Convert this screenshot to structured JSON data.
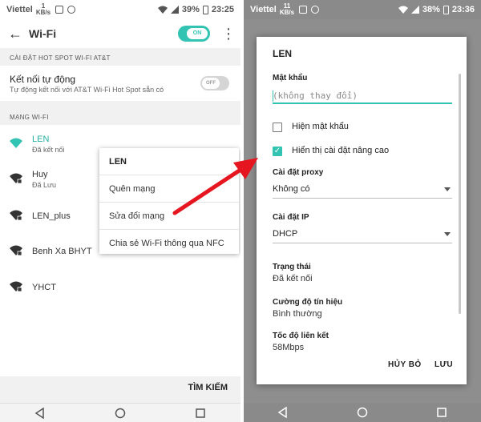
{
  "colors": {
    "accent": "#33c3b3",
    "arrow": "#e5161f"
  },
  "left": {
    "status": {
      "carrier": "Viettel",
      "mini_top": "1",
      "mini_bottom": "KB/s",
      "battery": "39%",
      "time": "23:25"
    },
    "appbar": {
      "title": "Wi-Fi",
      "toggle_label": "ON",
      "back_icon": "back-arrow-icon",
      "menu_icon": "more-vert-icon"
    },
    "hotspot_section": "CÀI ĐẶT HOT SPOT WI-FI AT&T",
    "auto_connect": {
      "title": "Kết nối tự động",
      "subtitle": "Tự động kết nối với AT&T Wi-Fi Hot Spot sẵn có",
      "toggle_label": "OFF"
    },
    "networks_section": "MẠNG WI-FI",
    "networks": [
      {
        "name": "LEN",
        "status": "Đã kết nối",
        "connected": true
      },
      {
        "name": "Huy",
        "status": "Đã Lưu",
        "connected": false
      },
      {
        "name": "LEN_plus",
        "status": "",
        "connected": false
      },
      {
        "name": "Benh Xa BHYT",
        "status": "",
        "connected": false
      },
      {
        "name": "YHCT",
        "status": "",
        "connected": false
      }
    ],
    "context_menu": {
      "title": "LEN",
      "items": [
        "Quên mạng",
        "Sửa đổi mạng",
        "Chia sẻ Wi-Fi thông qua NFC"
      ]
    },
    "search_label": "TÌM KIẾM"
  },
  "right": {
    "status": {
      "carrier": "Viettel",
      "mini_top": "11",
      "mini_bottom": "KB/s",
      "battery": "38%",
      "time": "23:36"
    },
    "dialog": {
      "title": "LEN",
      "password_label": "Mật khẩu",
      "password_placeholder": "(không thay đổi)",
      "show_password": {
        "label": "Hiện mật khẩu",
        "checked": false
      },
      "show_advanced": {
        "label": "Hiển thị cài đặt nâng cao",
        "checked": true
      },
      "proxy_label": "Cài đặt proxy",
      "proxy_value": "Không có",
      "ip_label": "Cài đặt IP",
      "ip_value": "DHCP",
      "state_label": "Trạng thái",
      "state_value": "Đã kết nối",
      "signal_label": "Cường độ tín hiệu",
      "signal_value": "Bình thường",
      "speed_label": "Tốc độ liên kết",
      "speed_value": "58Mbps",
      "cancel_label": "HỦY BỎ",
      "save_label": "LƯU"
    }
  }
}
